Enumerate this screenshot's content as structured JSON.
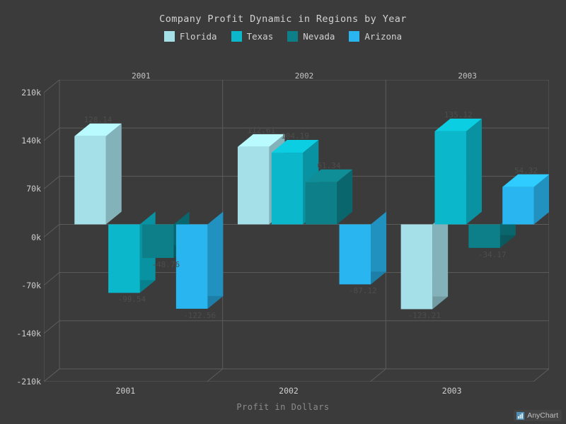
{
  "chart_data": {
    "type": "bar",
    "title": "Company Profit Dynamic in Regions by Year",
    "xlabel": "Profit in Dollars",
    "ylabel": "",
    "categories": [
      "2001",
      "2002",
      "2003"
    ],
    "ylim": [
      -210,
      210
    ],
    "ytick_labels": [
      "210k",
      "140k",
      "70k",
      "0k",
      "-70k",
      "-140k",
      "-210k"
    ],
    "ytick_values": [
      210,
      140,
      70,
      0,
      -70,
      -140,
      -210
    ],
    "grid": true,
    "legend_position": "top",
    "three_d": true,
    "series": [
      {
        "name": "Florida",
        "color": "#a5dfe8",
        "values": [
          128.14,
          112.61,
          -123.21
        ],
        "labels": [
          "128.14",
          "112.61",
          "-123.21"
        ]
      },
      {
        "name": "Texas",
        "color": "#0bb8cb",
        "values": [
          -99.54,
          104.19,
          135.12
        ],
        "labels": [
          "-99.54",
          "104.19",
          "135.12"
        ]
      },
      {
        "name": "Nevada",
        "color": "#0d7f88",
        "values": [
          -48.76,
          61.34,
          -34.17
        ],
        "labels": [
          "-48.76",
          "61.34",
          "-34.17"
        ]
      },
      {
        "name": "Arizona",
        "color": "#29b6f0",
        "values": [
          -122.56,
          -87.12,
          54.32
        ],
        "labels": [
          "-122.56",
          "-87.12",
          "54.32"
        ]
      }
    ]
  },
  "legend": {
    "items": [
      {
        "label": "Florida",
        "color": "#a5dfe8"
      },
      {
        "label": "Texas",
        "color": "#0bb8cb"
      },
      {
        "label": "Nevada",
        "color": "#0d7f88"
      },
      {
        "label": "Arizona",
        "color": "#29b6f0"
      }
    ]
  },
  "top_axis": {
    "labels": [
      "2001",
      "2002",
      "2003"
    ]
  },
  "watermark": {
    "text": "AnyChart",
    "icon": "bar-chart-icon"
  },
  "colors": {
    "background": "#3b3b3b",
    "title_text": "#d2d2d2",
    "tick_text": "#cfcfcf",
    "axis_title_text": "#8c8c8c",
    "grid_line": "#5c5c5c",
    "data_label_text": "#4d4d4d"
  }
}
